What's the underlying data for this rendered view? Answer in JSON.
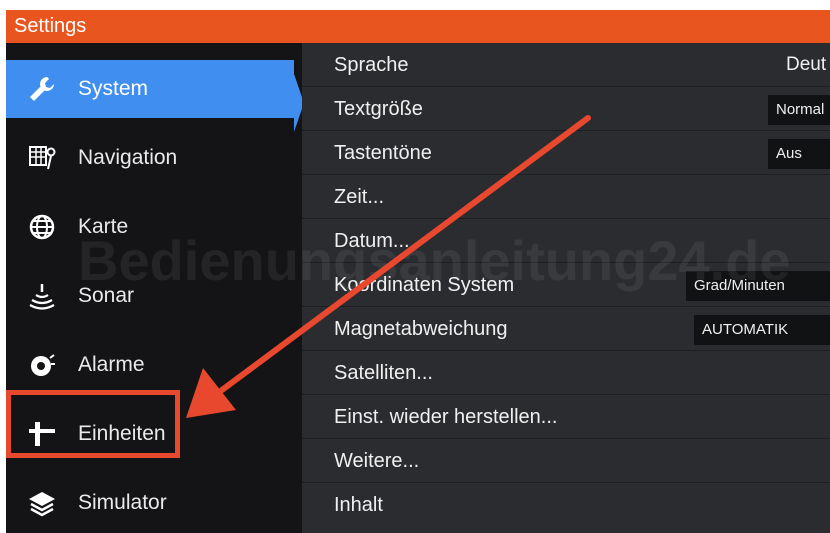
{
  "window": {
    "title": "Settings"
  },
  "sidebar": {
    "items": [
      {
        "label": "System",
        "icon": "wrench-icon",
        "active": true
      },
      {
        "label": "Navigation",
        "icon": "navigation-icon"
      },
      {
        "label": "Karte",
        "icon": "globe-icon"
      },
      {
        "label": "Sonar",
        "icon": "sonar-icon"
      },
      {
        "label": "Alarme",
        "icon": "alarm-bell-icon"
      },
      {
        "label": "Einheiten",
        "icon": "units-icon"
      },
      {
        "label": "Simulator",
        "icon": "layers-icon"
      }
    ]
  },
  "settings": {
    "rows": [
      {
        "label": "Sprache",
        "value": "Deut"
      },
      {
        "label": "Textgröße",
        "value": "Normal"
      },
      {
        "label": "Tastentöne",
        "value": "Aus"
      },
      {
        "label": "Zeit..."
      },
      {
        "label": "Datum..."
      },
      {
        "label": "Koordinaten System",
        "value": "Grad/Minuten"
      },
      {
        "label": "Magnetabweichung",
        "value": "AUTOMATIK"
      },
      {
        "label": "Satelliten..."
      },
      {
        "label": "Einst. wieder herstellen..."
      },
      {
        "label": "Weitere..."
      },
      {
        "label": "Inhalt"
      }
    ]
  },
  "watermark": {
    "text": "Bedienungsanleitung24.de"
  },
  "colors": {
    "title_bar": "#e8551e",
    "active_item": "#3f8ef0",
    "annotation": "#e8482d",
    "content_bg": "#2b2c30"
  }
}
